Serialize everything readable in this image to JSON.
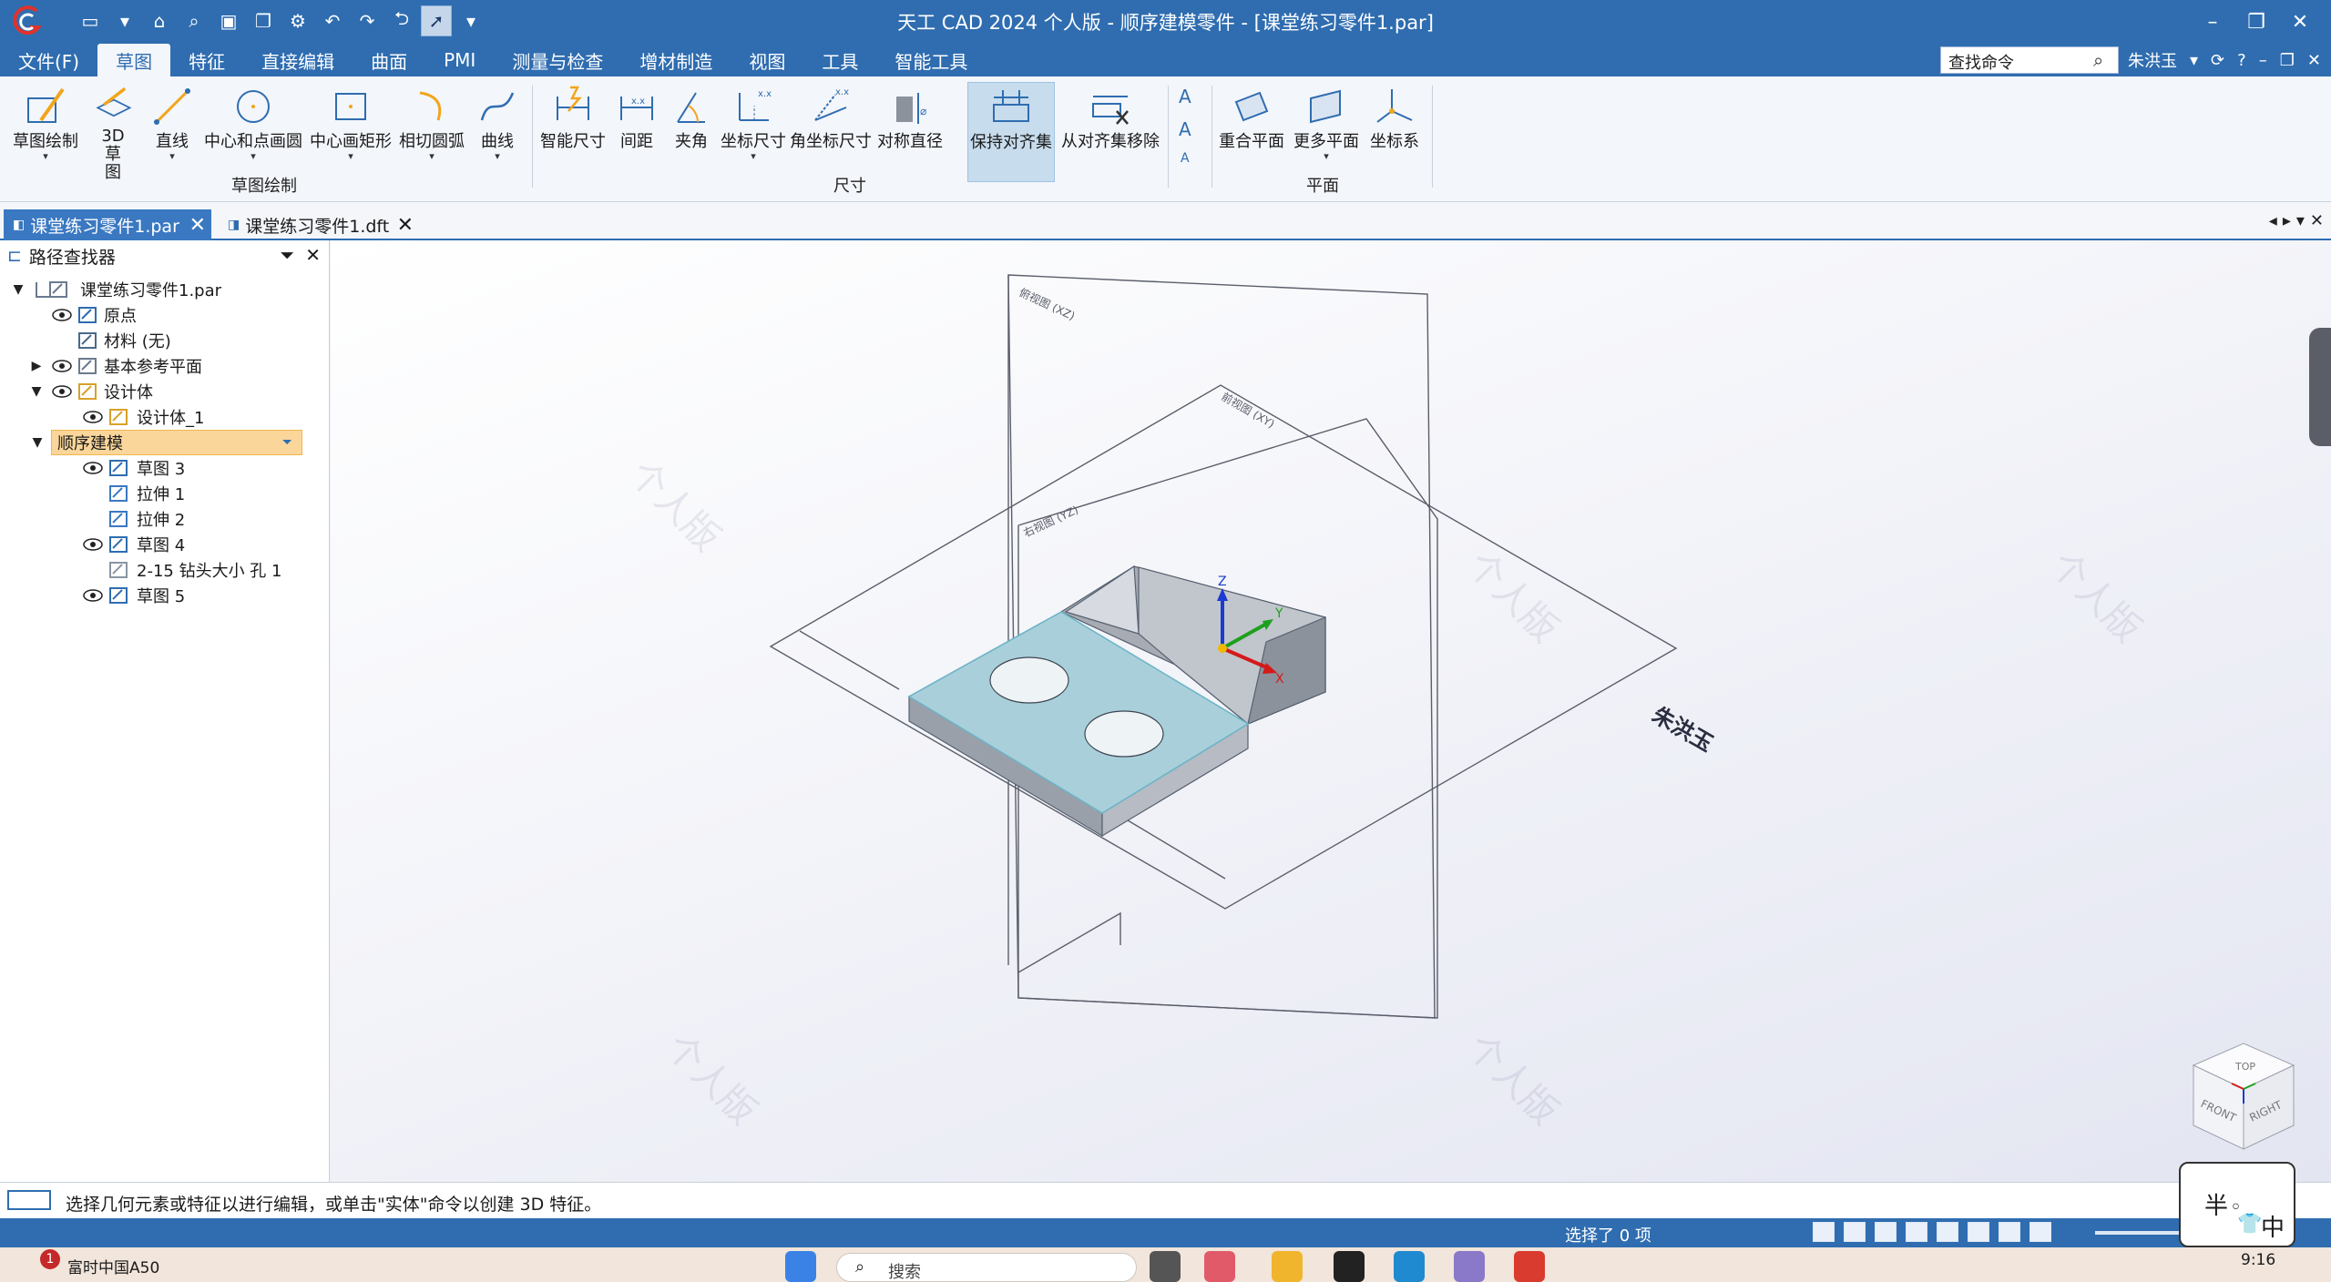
{
  "window": {
    "title": "天工 CAD 2024 个人版 - 顺序建模零件 - [课堂练习零件1.par]"
  },
  "qat": {
    "icons": [
      "new-icon",
      "open-icon",
      "find-icon",
      "save-icon",
      "save-as-icon",
      "settings-icon",
      "undo-icon",
      "redo-icon",
      "back-icon",
      "select-icon"
    ]
  },
  "menu": {
    "tabs": [
      "文件(F)",
      "草图",
      "特征",
      "直接编辑",
      "曲面",
      "PMI",
      "测量与检查",
      "增材制造",
      "视图",
      "工具",
      "智能工具"
    ],
    "active_index": 1
  },
  "search": {
    "value": "查找命令"
  },
  "user": {
    "name": "朱洪玉"
  },
  "ribbon": {
    "sketch_group": {
      "label": "草图绘制",
      "buttons": [
        "草图绘制",
        "3D 草图",
        "直线",
        "中心和点画圆",
        "中心画矩形",
        "相切圆弧",
        "曲线"
      ]
    },
    "dim_group": {
      "label": "尺寸",
      "buttons": [
        "智能尺寸",
        "间距",
        "夹角",
        "坐标尺寸",
        "角坐标尺寸",
        "对称直径",
        "保持对齐集",
        "从对齐集移除"
      ]
    },
    "plane_group": {
      "label": "平面",
      "buttons": [
        "重合平面",
        "更多平面",
        "坐标系"
      ]
    }
  },
  "doc_tabs": [
    {
      "label": "课堂练习零件1.par",
      "active": true
    },
    {
      "label": "课堂练习零件1.dft",
      "active": false
    }
  ],
  "pathfinder": {
    "title": "路径查找器",
    "tree": [
      {
        "label": "课堂练习零件1.par",
        "icon": "part-icon"
      },
      {
        "label": "原点",
        "icon": "origin-icon"
      },
      {
        "label": "材料 (无)",
        "icon": "material-icon"
      },
      {
        "label": "基本参考平面",
        "icon": "plane-icon"
      },
      {
        "label": "设计体",
        "icon": "design-body-icon"
      },
      {
        "label": "设计体_1",
        "icon": "body-icon"
      },
      {
        "label": "顺序建模",
        "icon": "ordered-icon"
      },
      {
        "label": "草图 3",
        "icon": "sketch-icon"
      },
      {
        "label": "拉伸 1",
        "icon": "extrude-icon"
      },
      {
        "label": "拉伸 2",
        "icon": "extrude-icon"
      },
      {
        "label": "草图 4",
        "icon": "sketch-icon"
      },
      {
        "label": "2-15 钻头大小 孔 1",
        "icon": "hole-icon"
      },
      {
        "label": "草图 5",
        "icon": "sketch-icon"
      }
    ]
  },
  "viewport": {
    "plane_labels": [
      "俯视图 (XZ)",
      "前视图 (XY)",
      "右视图 (YZ)"
    ],
    "axis_labels": [
      "Z",
      "Y",
      "X"
    ],
    "watermark": "个人版",
    "sketch_text": "朱洪玉",
    "viewcube": [
      "TOP",
      "FRONT",
      "RIGHT"
    ]
  },
  "status": {
    "message": "选择几何元素或特征以进行编辑，或单击\"实体\"命令以创建 3D 特征。",
    "selection": "选择了 0 项"
  },
  "ime": {
    "left": "半",
    "right": "中"
  },
  "taskbar": {
    "news_badge": "1",
    "news": "富时中国A50",
    "search": "搜索",
    "time": "9:16"
  },
  "colors": {
    "accent": "#2f6db0",
    "selected_face": "#a9d0da",
    "tree_highlight": "#fad69a"
  }
}
